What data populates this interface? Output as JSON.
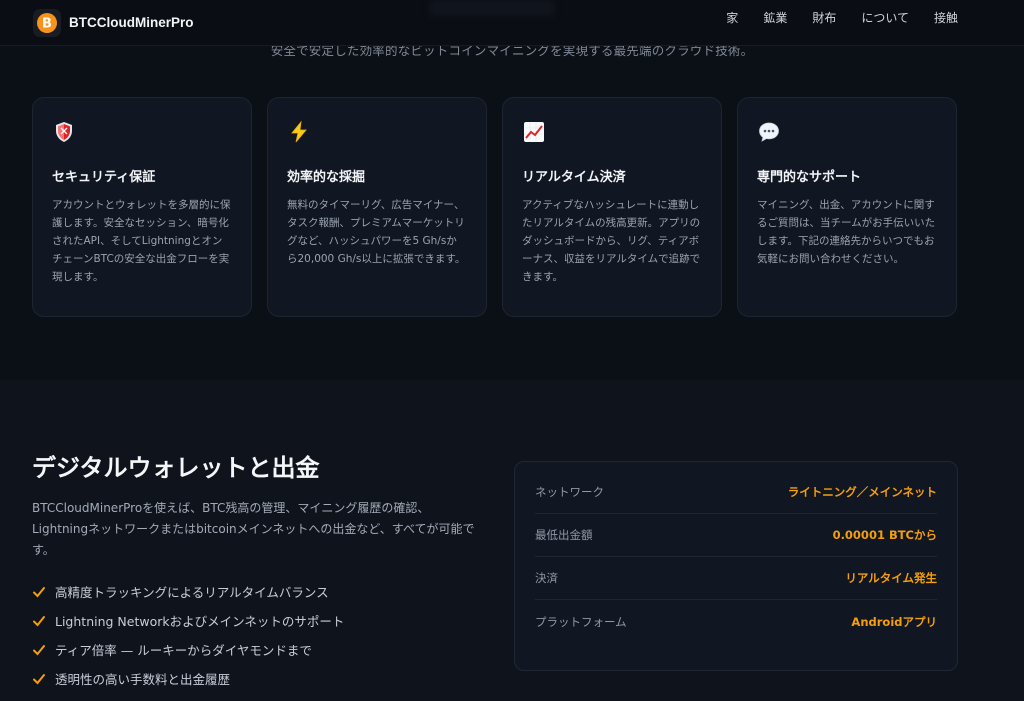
{
  "brand": {
    "name": "BTCCloudMinerPro",
    "logo_glyph": "B"
  },
  "nav": {
    "links": [
      "家",
      "鉱業",
      "財布",
      "について",
      "接触"
    ]
  },
  "hero": {
    "subtitle": "安全で安定した効率的なビットコインマイニングを実現する最先端のクラウド技術。"
  },
  "features": [
    {
      "icon": "shield-icon",
      "title": "セキュリティ保証",
      "desc": "アカウントとウォレットを多層的に保護します。安全なセッション、暗号化されたAPI、そしてLightningとオンチェーンBTCの安全な出金フローを実現します。"
    },
    {
      "icon": "lightning-icon",
      "title": "効率的な採掘",
      "desc": "無料のタイマーリグ、広告マイナー、タスク報酬、プレミアムマーケットリグなど、ハッシュパワーを5 Gh/sから20,000 Gh/s以上に拡張できます。"
    },
    {
      "icon": "chart-up-icon",
      "title": "リアルタイム決済",
      "desc": "アクティブなハッシュレートに連動したリアルタイムの残高更新。アプリのダッシュボードから、リグ、ティアボーナス、収益をリアルタイムで追跡できます。"
    },
    {
      "icon": "speech-bubble-icon",
      "title": "専門的なサポート",
      "desc": "マイニング、出金、アカウントに関するご質問は、当チームがお手伝いいたします。下記の連絡先からいつでもお気軽にお問い合わせください。"
    }
  ],
  "wallet": {
    "title": "デジタルウォレットと出金",
    "lead": "BTCCloudMinerProを使えば、BTC残高の管理、マイニング履歴の確認、Lightningネットワークまたはbitcoinメインネットへの出金など、すべてが可能です。",
    "checks": [
      "高精度トラッキングによるリアルタイムバランス",
      "Lightning Networkおよびメインネットのサポート",
      "ティア倍率 — ルーキーからダイヤモンドまで",
      "透明性の高い手数料と出金履歴"
    ],
    "specs": [
      {
        "label": "ネットワーク",
        "value": "ライトニング／メインネット"
      },
      {
        "label": "最低出金額",
        "value": "0.00001 BTCから"
      },
      {
        "label": "決済",
        "value": "リアルタイム発生"
      },
      {
        "label": "プラットフォーム",
        "value": "Androidアプリ"
      }
    ]
  },
  "colors": {
    "accent": "#f7931a",
    "check": "#f59e0b",
    "background": "#0b0f16",
    "card": "#111722"
  }
}
